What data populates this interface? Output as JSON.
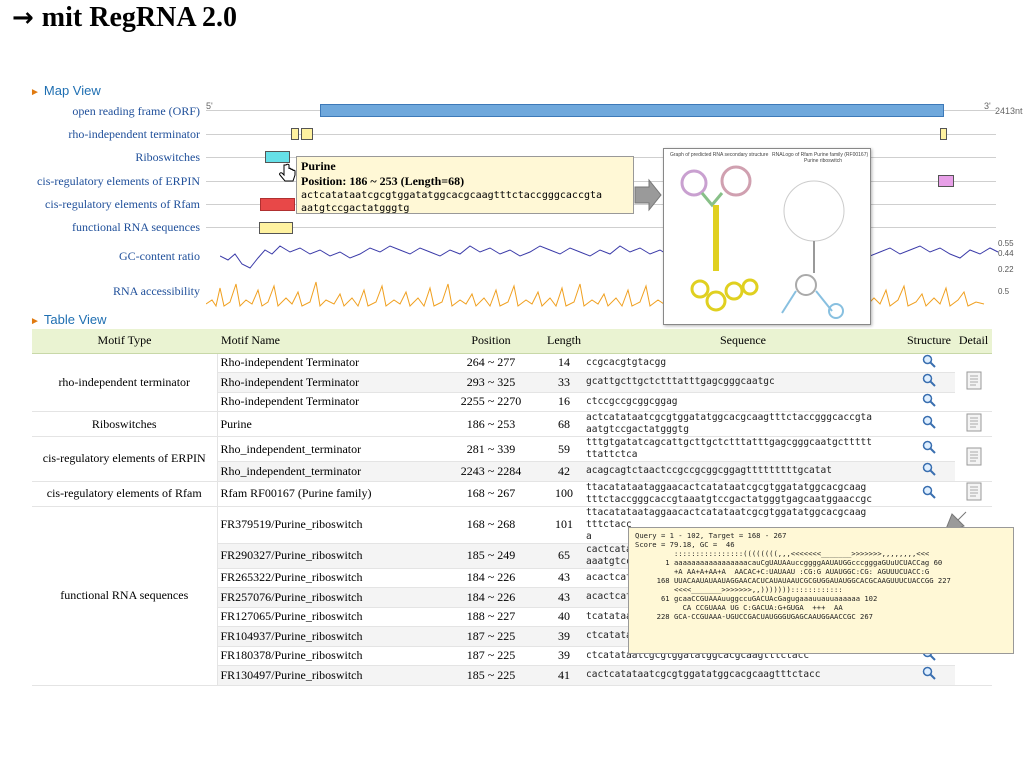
{
  "slide": {
    "arrow": "→",
    "title": "mit RegRNA 2.0"
  },
  "map_view": {
    "label": "Map View",
    "five_prime": "5'",
    "three_prime": "3'",
    "length_tag": "2413nt",
    "tracks": [
      "open reading frame (ORF)",
      "rho-independent terminator",
      "Riboswitches",
      "cis-regulatory elements of ERPIN",
      "cis-regulatory elements of Rfam",
      "functional RNA sequences",
      "GC-content ratio",
      "RNA accessibility"
    ],
    "gc_ticks": [
      "0.55",
      "0.44",
      "0.22"
    ],
    "access_tick": "0.5",
    "colors": {
      "orf": "#6fa8dc",
      "terminator": "#fff2a0",
      "riboswitch": "#66e0e8",
      "erpin": "#e8a0e8",
      "rfam": "#e84848",
      "functional": "#fff2a0",
      "gc": "#3a3aa8",
      "access": "#f0a020"
    }
  },
  "tooltip": {
    "title": "Purine",
    "position": "Position: 186 ~ 253 (Length=68)",
    "seq1": "actcatataatcgcgtggatatggcacgcaagtttctaccgggcaccgta",
    "seq2": "aatgtccgactatgggtg"
  },
  "structure_panel": {
    "caption_left": "Graph of predicted RNA secondary structure",
    "caption_right": "RNALogo of Rfam Purine family (RF00167)",
    "sub_right": "Purine riboswitch"
  },
  "table_view": {
    "label": "Table View",
    "headers": [
      "Motif Type",
      "Motif Name",
      "Position",
      "Length",
      "Sequence",
      "Structure",
      "Detail"
    ],
    "groups": {
      "terminator": "rho-independent terminator",
      "riboswitch": "Riboswitches",
      "erpin": "cis-regulatory elements of ERPIN",
      "rfam": "cis-regulatory elements of Rfam",
      "functional": "functional RNA sequences"
    },
    "rows": [
      {
        "name": "Rho-independent Terminator",
        "pos": "264 ~ 277",
        "len": "14",
        "seq": "ccgcacgtgtacgg"
      },
      {
        "name": "Rho-independent Terminator",
        "pos": "293 ~ 325",
        "len": "33",
        "seq": "gcattgcttgctctttatttgagcgggcaatgc"
      },
      {
        "name": "Rho-independent Terminator",
        "pos": "2255 ~ 2270",
        "len": "16",
        "seq": "ctccgccgcggcggag"
      },
      {
        "name": "Purine",
        "pos": "186 ~ 253",
        "len": "68",
        "seq": "actcatataatcgcgtggatatggcacgcaagtttctaccgggcaccgta",
        "seq2": "aatgtccgactatgggtg"
      },
      {
        "name": "Rho_independent_terminator",
        "pos": "281 ~ 339",
        "len": "59",
        "seq": "tttgtgatatcagcattgcttgctctttatttgagcgggcaatgcttttt",
        "seq2": "ttattctca"
      },
      {
        "name": "Rho_independent_terminator",
        "pos": "2243 ~ 2284",
        "len": "42",
        "seq": "acagcagtctaactccgccgcggcggagtttttttttgcatat"
      },
      {
        "name": "Rfam RF00167 (Purine family)",
        "pos": "168 ~ 267",
        "len": "100",
        "seq": "ttacatataataggaacactcatataatcgcgtggatatggcacgcaag",
        "seq2": "tttctaccgggcaccgtaaatgtccgactatgggtgagcaatggaaccgc"
      },
      {
        "name": "FR379519/Purine_riboswitch",
        "pos": "168 ~ 268",
        "len": "101",
        "seq": "ttacatataataggaacactcatataatcgcgtggatatggcacgcaag",
        "seq2": "tttctacc",
        "seq3": "a"
      },
      {
        "name": "FR290327/Purine_riboswitch",
        "pos": "185 ~ 249",
        "len": "65",
        "seq": "cactcata",
        "seq2": "aaatgtccga"
      },
      {
        "name": "FR265322/Purine_riboswitch",
        "pos": "184 ~ 226",
        "len": "43",
        "seq": "acactcatat"
      },
      {
        "name": "FR257076/Purine_riboswitch",
        "pos": "184 ~ 226",
        "len": "43",
        "seq": "acactcatat"
      },
      {
        "name": "FR127065/Purine_riboswitch",
        "pos": "188 ~ 227",
        "len": "40",
        "seq": "tcatataatc"
      },
      {
        "name": "FR104937/Purine_riboswitch",
        "pos": "187 ~ 225",
        "len": "39",
        "seq": "ctcatataat"
      },
      {
        "name": "FR180378/Purine_riboswitch",
        "pos": "187 ~ 225",
        "len": "39",
        "seq": "ctcatataatcgcgtggatatggcacgcaagtttctacc"
      },
      {
        "name": "FR130497/Purine_riboswitch",
        "pos": "185 ~ 225",
        "len": "41",
        "seq": "cactcatataatcgcgtggatatggcacgcaagtttctacc"
      }
    ]
  },
  "query_panel": {
    "line1": "Query = 1 - 102, Target = 168 - 267",
    "line2": "Score = 79.18, GC =  46",
    "line3": "",
    "line4": "         ::::::::::::::::((((((((,,,<<<<<<<_______>>>>>>>,,,,,,,,<<<",
    "line5": "       1 aaaaaaaaaaaaaaaaacauCgUAUAAuccggggAAUAUGGcccgggaGUuUCUACCag 60",
    "line6": "         +A AA+A+AA+A  AACAC+C:UAUAAU :CG:G AUAUGGC:CG: AGUUUCUACC:G",
    "line7": "     168 UUACAAUAUAAUAGGAACACUCAUAUAAUCGCGUGGAUAUGGCACGCAAGUUUCUACCGG 227",
    "line8": "",
    "line9": "         <<<<_______>>>>>>>,,)))))))::::::::::::",
    "line10": "      61 gcaaCCGUAAAuuggccuGACUAcGagugaaauuauuaaaaaa 102",
    "line11": "           CA CCGUAAA UG C:GACUA:G+GUGA  +++  AA",
    "line12": "     228 GCA-CCGUAAA-UGUCCGACUAUGGGUGAGCAAUGGAACCGC 267"
  }
}
